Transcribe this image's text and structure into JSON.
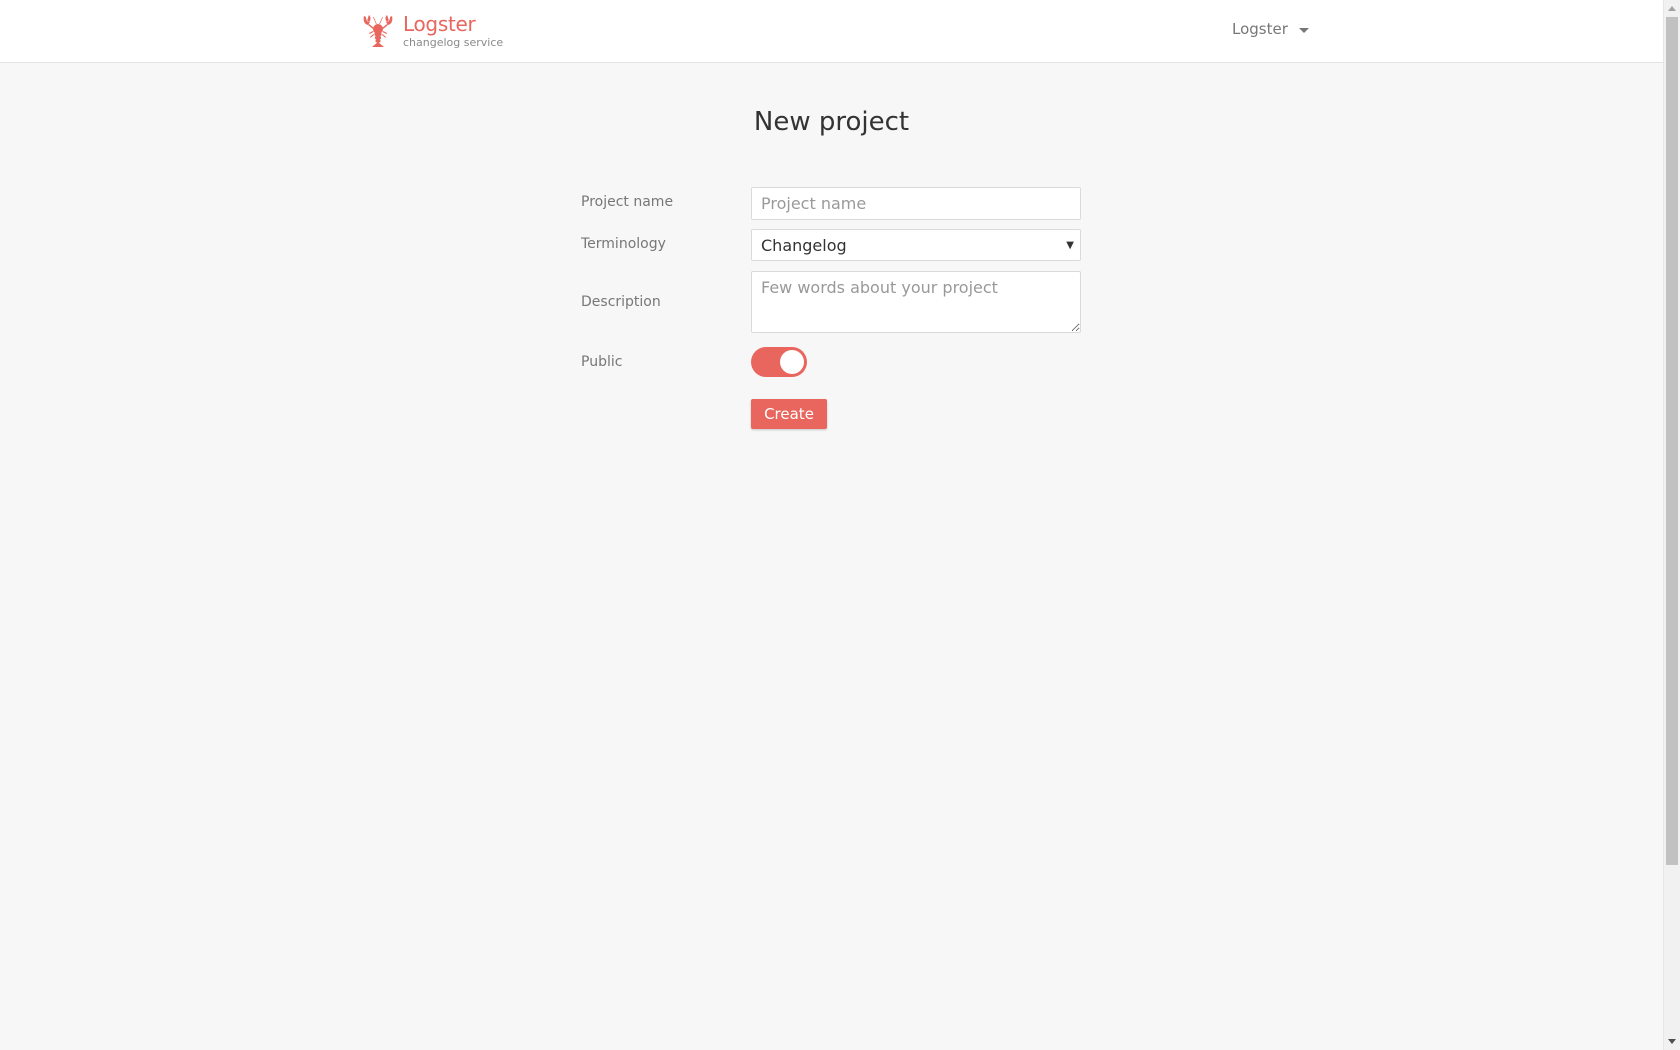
{
  "brand": {
    "name": "Logster",
    "tagline": "changelog service",
    "color": "#e8665d"
  },
  "user_menu": {
    "name": "Logster"
  },
  "page": {
    "title": "New project"
  },
  "form": {
    "project_name": {
      "label": "Project name",
      "placeholder": "Project name",
      "value": ""
    },
    "terminology": {
      "label": "Terminology",
      "selected": "Changelog"
    },
    "description": {
      "label": "Description",
      "placeholder": "Few words about your project",
      "value": ""
    },
    "public": {
      "label": "Public",
      "checked": true
    },
    "submit_label": "Create"
  },
  "icons": {
    "logo": "lobster-icon",
    "user_caret": "caret-down-icon",
    "select_arrow": "caret-down-icon"
  }
}
